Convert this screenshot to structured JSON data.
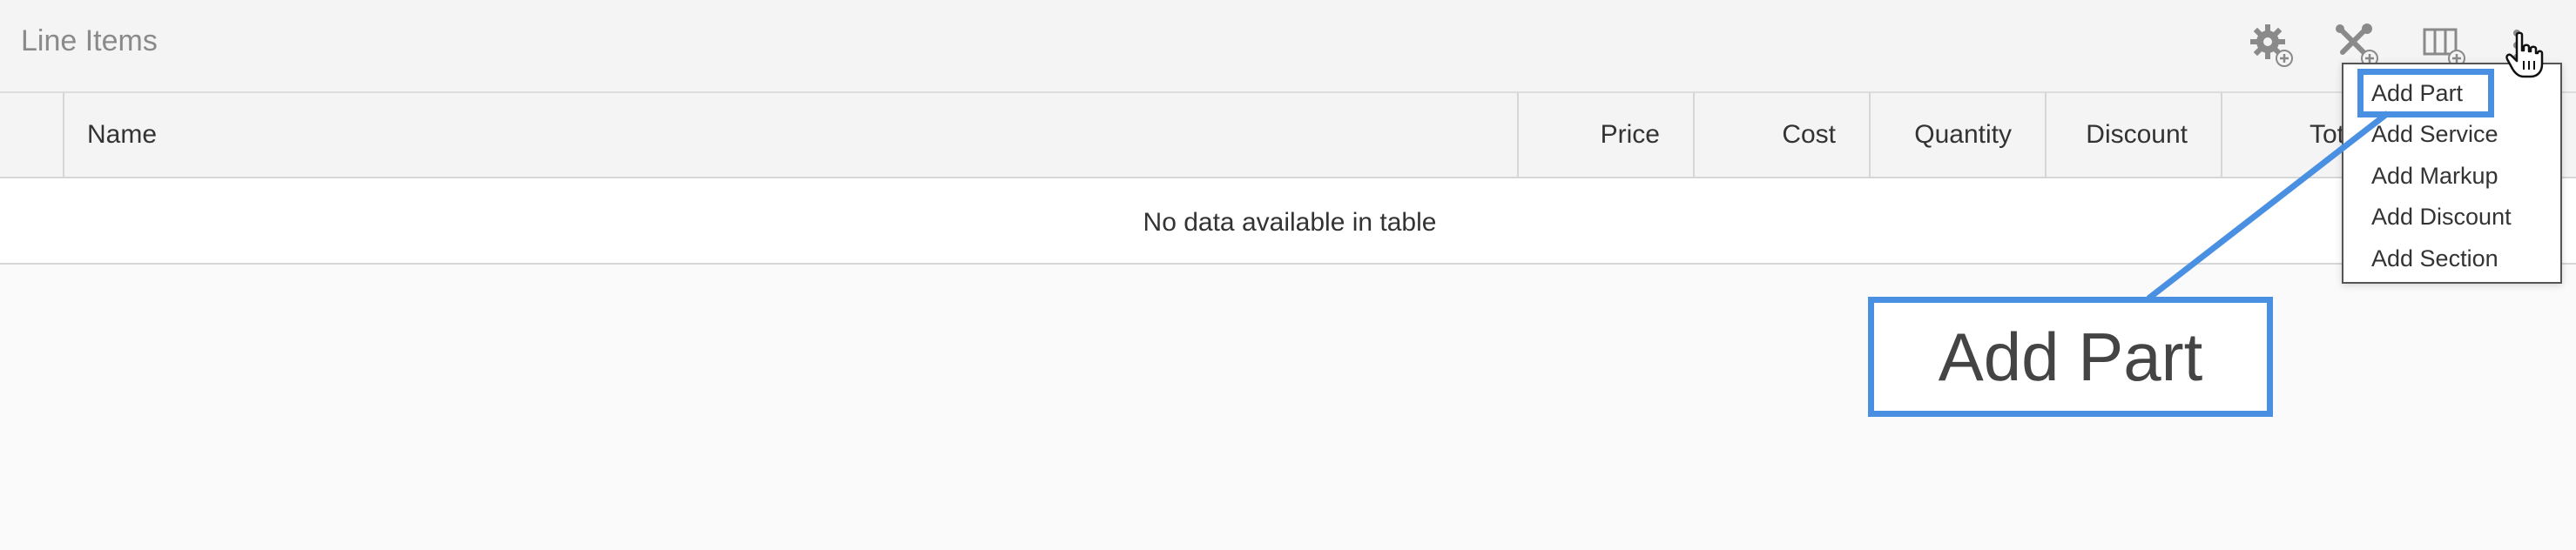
{
  "header": {
    "title": "Line Items",
    "icons": [
      "gear-plus-icon",
      "tools-plus-icon",
      "columns-plus-icon",
      "kebab-menu-icon"
    ]
  },
  "table": {
    "columns": [
      "",
      "Name",
      "Price",
      "Cost",
      "Quantity",
      "Discount",
      "Tot"
    ],
    "empty_message": "No data available in table"
  },
  "menu": {
    "items": [
      "Add Part",
      "Add Service",
      "Add Markup",
      "Add Discount",
      "Add Section"
    ]
  },
  "callout": {
    "label": "Add Part",
    "color": "#4a90e2"
  }
}
